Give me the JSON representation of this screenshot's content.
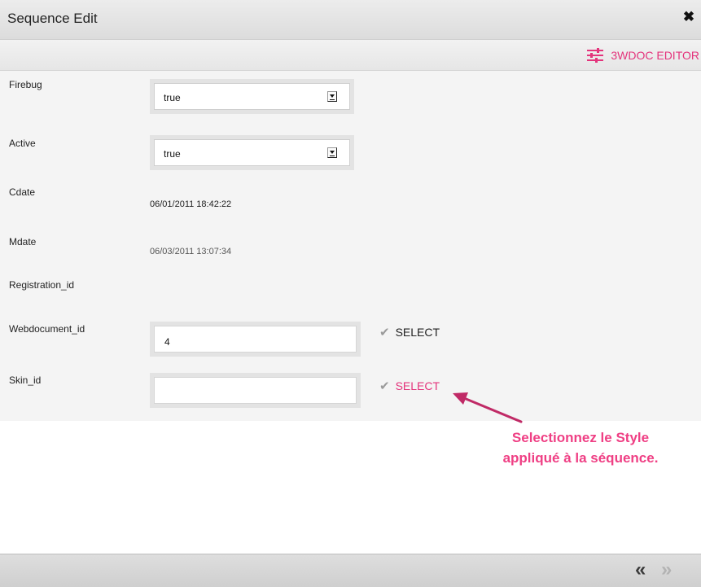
{
  "window": {
    "title": "Sequence Edit",
    "close_icon": "close-icon"
  },
  "toolbar": {
    "editor_label": "3WDOC EDITOR",
    "editor_icon": "sliders-icon",
    "accent": "#e4347c"
  },
  "form": {
    "firebug": {
      "label": "Firebug",
      "value": "true"
    },
    "active": {
      "label": "Active",
      "value": "true"
    },
    "cdate": {
      "label": "Cdate",
      "value": "06/01/2011 18:42:22"
    },
    "mdate": {
      "label": "Mdate",
      "value": "06/03/2011 13:07:34"
    },
    "registration": {
      "label": "Registration_id"
    },
    "webdocument": {
      "label": "Webdocument_id",
      "value": "4",
      "select_label": "SELECT"
    },
    "skin": {
      "label": "Skin_id",
      "value": "",
      "select_label": "SELECT"
    }
  },
  "callout": {
    "line1": "Selectionnez le Style",
    "line2": "appliqué à la séquence.",
    "color": "#ef3f84"
  },
  "footer": {
    "prev_icon": "«",
    "next_icon": "»"
  }
}
